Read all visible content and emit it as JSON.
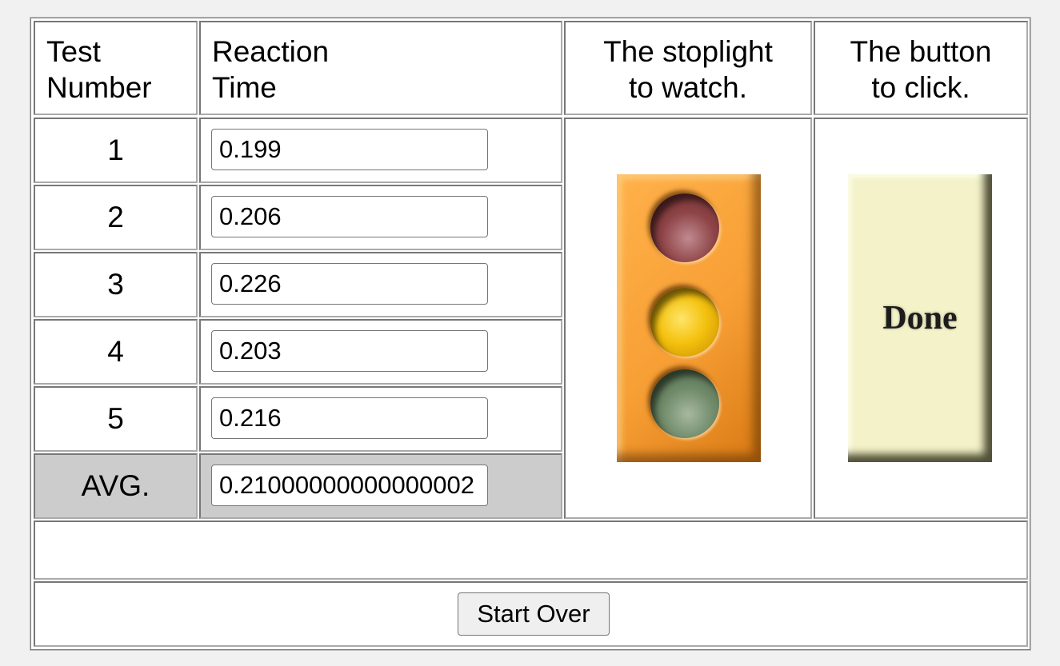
{
  "headers": {
    "test_number": [
      "Test",
      "Number"
    ],
    "reaction_time": [
      "Reaction",
      "Time"
    ],
    "stoplight": [
      "The stoplight",
      "to watch."
    ],
    "button": [
      "The button",
      "to click."
    ]
  },
  "rows": [
    {
      "number": "1",
      "value": "0.199"
    },
    {
      "number": "2",
      "value": "0.206"
    },
    {
      "number": "3",
      "value": "0.226"
    },
    {
      "number": "4",
      "value": "0.203"
    },
    {
      "number": "5",
      "value": "0.216"
    }
  ],
  "average": {
    "label": "AVG.",
    "value": "0.21000000000000002"
  },
  "done_button": {
    "label": "Done"
  },
  "start_over": {
    "label": "Start Over"
  },
  "stoplight_lights": [
    "red",
    "yellow",
    "green"
  ],
  "colors": {
    "stoplight_body": "#f79f35",
    "done_bg": "#f4f2c8",
    "avg_bg": "#cccccc"
  }
}
